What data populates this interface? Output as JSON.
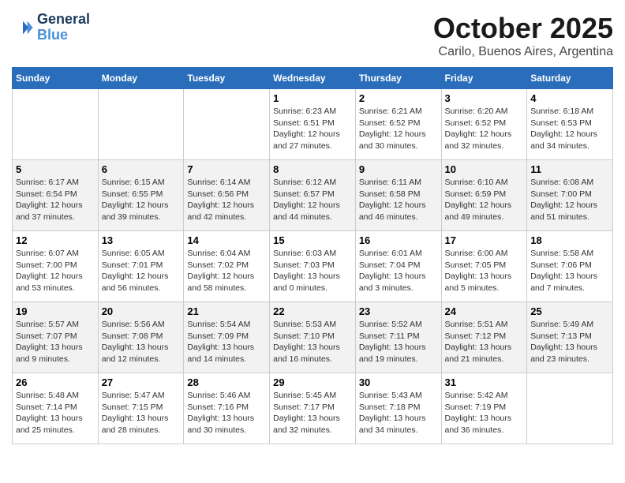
{
  "logo": {
    "line1": "General",
    "line2": "Blue"
  },
  "title": "October 2025",
  "subtitle": "Carilo, Buenos Aires, Argentina",
  "headers": [
    "Sunday",
    "Monday",
    "Tuesday",
    "Wednesday",
    "Thursday",
    "Friday",
    "Saturday"
  ],
  "weeks": [
    [
      {
        "day": "",
        "sunrise": "",
        "sunset": "",
        "daylight": ""
      },
      {
        "day": "",
        "sunrise": "",
        "sunset": "",
        "daylight": ""
      },
      {
        "day": "",
        "sunrise": "",
        "sunset": "",
        "daylight": ""
      },
      {
        "day": "1",
        "sunrise": "Sunrise: 6:23 AM",
        "sunset": "Sunset: 6:51 PM",
        "daylight": "Daylight: 12 hours and 27 minutes."
      },
      {
        "day": "2",
        "sunrise": "Sunrise: 6:21 AM",
        "sunset": "Sunset: 6:52 PM",
        "daylight": "Daylight: 12 hours and 30 minutes."
      },
      {
        "day": "3",
        "sunrise": "Sunrise: 6:20 AM",
        "sunset": "Sunset: 6:52 PM",
        "daylight": "Daylight: 12 hours and 32 minutes."
      },
      {
        "day": "4",
        "sunrise": "Sunrise: 6:18 AM",
        "sunset": "Sunset: 6:53 PM",
        "daylight": "Daylight: 12 hours and 34 minutes."
      }
    ],
    [
      {
        "day": "5",
        "sunrise": "Sunrise: 6:17 AM",
        "sunset": "Sunset: 6:54 PM",
        "daylight": "Daylight: 12 hours and 37 minutes."
      },
      {
        "day": "6",
        "sunrise": "Sunrise: 6:15 AM",
        "sunset": "Sunset: 6:55 PM",
        "daylight": "Daylight: 12 hours and 39 minutes."
      },
      {
        "day": "7",
        "sunrise": "Sunrise: 6:14 AM",
        "sunset": "Sunset: 6:56 PM",
        "daylight": "Daylight: 12 hours and 42 minutes."
      },
      {
        "day": "8",
        "sunrise": "Sunrise: 6:12 AM",
        "sunset": "Sunset: 6:57 PM",
        "daylight": "Daylight: 12 hours and 44 minutes."
      },
      {
        "day": "9",
        "sunrise": "Sunrise: 6:11 AM",
        "sunset": "Sunset: 6:58 PM",
        "daylight": "Daylight: 12 hours and 46 minutes."
      },
      {
        "day": "10",
        "sunrise": "Sunrise: 6:10 AM",
        "sunset": "Sunset: 6:59 PM",
        "daylight": "Daylight: 12 hours and 49 minutes."
      },
      {
        "day": "11",
        "sunrise": "Sunrise: 6:08 AM",
        "sunset": "Sunset: 7:00 PM",
        "daylight": "Daylight: 12 hours and 51 minutes."
      }
    ],
    [
      {
        "day": "12",
        "sunrise": "Sunrise: 6:07 AM",
        "sunset": "Sunset: 7:00 PM",
        "daylight": "Daylight: 12 hours and 53 minutes."
      },
      {
        "day": "13",
        "sunrise": "Sunrise: 6:05 AM",
        "sunset": "Sunset: 7:01 PM",
        "daylight": "Daylight: 12 hours and 56 minutes."
      },
      {
        "day": "14",
        "sunrise": "Sunrise: 6:04 AM",
        "sunset": "Sunset: 7:02 PM",
        "daylight": "Daylight: 12 hours and 58 minutes."
      },
      {
        "day": "15",
        "sunrise": "Sunrise: 6:03 AM",
        "sunset": "Sunset: 7:03 PM",
        "daylight": "Daylight: 13 hours and 0 minutes."
      },
      {
        "day": "16",
        "sunrise": "Sunrise: 6:01 AM",
        "sunset": "Sunset: 7:04 PM",
        "daylight": "Daylight: 13 hours and 3 minutes."
      },
      {
        "day": "17",
        "sunrise": "Sunrise: 6:00 AM",
        "sunset": "Sunset: 7:05 PM",
        "daylight": "Daylight: 13 hours and 5 minutes."
      },
      {
        "day": "18",
        "sunrise": "Sunrise: 5:58 AM",
        "sunset": "Sunset: 7:06 PM",
        "daylight": "Daylight: 13 hours and 7 minutes."
      }
    ],
    [
      {
        "day": "19",
        "sunrise": "Sunrise: 5:57 AM",
        "sunset": "Sunset: 7:07 PM",
        "daylight": "Daylight: 13 hours and 9 minutes."
      },
      {
        "day": "20",
        "sunrise": "Sunrise: 5:56 AM",
        "sunset": "Sunset: 7:08 PM",
        "daylight": "Daylight: 13 hours and 12 minutes."
      },
      {
        "day": "21",
        "sunrise": "Sunrise: 5:54 AM",
        "sunset": "Sunset: 7:09 PM",
        "daylight": "Daylight: 13 hours and 14 minutes."
      },
      {
        "day": "22",
        "sunrise": "Sunrise: 5:53 AM",
        "sunset": "Sunset: 7:10 PM",
        "daylight": "Daylight: 13 hours and 16 minutes."
      },
      {
        "day": "23",
        "sunrise": "Sunrise: 5:52 AM",
        "sunset": "Sunset: 7:11 PM",
        "daylight": "Daylight: 13 hours and 19 minutes."
      },
      {
        "day": "24",
        "sunrise": "Sunrise: 5:51 AM",
        "sunset": "Sunset: 7:12 PM",
        "daylight": "Daylight: 13 hours and 21 minutes."
      },
      {
        "day": "25",
        "sunrise": "Sunrise: 5:49 AM",
        "sunset": "Sunset: 7:13 PM",
        "daylight": "Daylight: 13 hours and 23 minutes."
      }
    ],
    [
      {
        "day": "26",
        "sunrise": "Sunrise: 5:48 AM",
        "sunset": "Sunset: 7:14 PM",
        "daylight": "Daylight: 13 hours and 25 minutes."
      },
      {
        "day": "27",
        "sunrise": "Sunrise: 5:47 AM",
        "sunset": "Sunset: 7:15 PM",
        "daylight": "Daylight: 13 hours and 28 minutes."
      },
      {
        "day": "28",
        "sunrise": "Sunrise: 5:46 AM",
        "sunset": "Sunset: 7:16 PM",
        "daylight": "Daylight: 13 hours and 30 minutes."
      },
      {
        "day": "29",
        "sunrise": "Sunrise: 5:45 AM",
        "sunset": "Sunset: 7:17 PM",
        "daylight": "Daylight: 13 hours and 32 minutes."
      },
      {
        "day": "30",
        "sunrise": "Sunrise: 5:43 AM",
        "sunset": "Sunset: 7:18 PM",
        "daylight": "Daylight: 13 hours and 34 minutes."
      },
      {
        "day": "31",
        "sunrise": "Sunrise: 5:42 AM",
        "sunset": "Sunset: 7:19 PM",
        "daylight": "Daylight: 13 hours and 36 minutes."
      },
      {
        "day": "",
        "sunrise": "",
        "sunset": "",
        "daylight": ""
      }
    ]
  ]
}
